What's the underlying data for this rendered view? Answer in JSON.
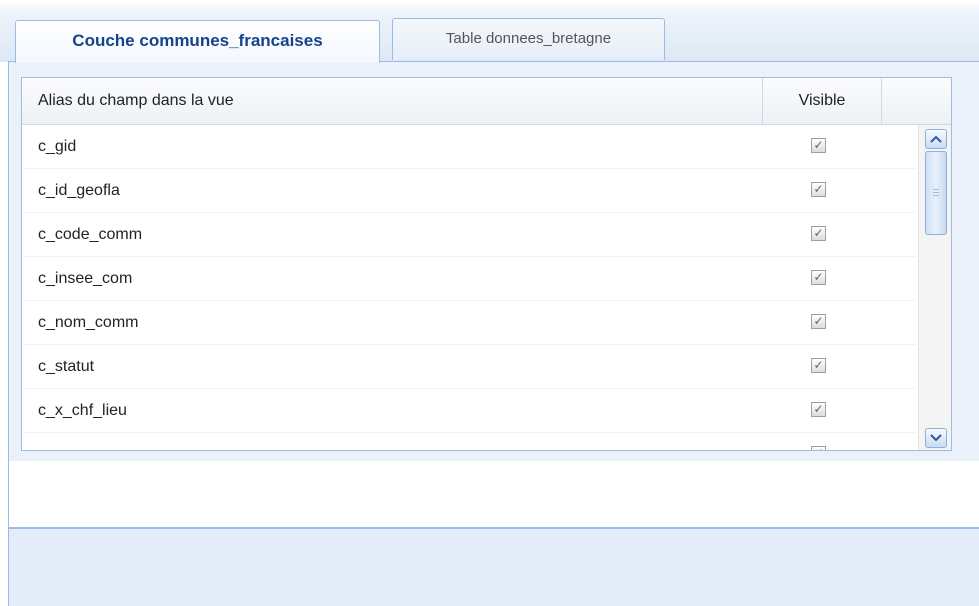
{
  "tabs": [
    {
      "label": "Couche communes_francaises",
      "active": true
    },
    {
      "label": "Table donnees_bretagne",
      "active": false
    }
  ],
  "grid": {
    "columns": [
      "Alias du champ dans la vue",
      "Visible"
    ],
    "rows": [
      {
        "alias": "c_gid",
        "visible": true
      },
      {
        "alias": "c_id_geofla",
        "visible": true
      },
      {
        "alias": "c_code_comm",
        "visible": true
      },
      {
        "alias": "c_insee_com",
        "visible": true
      },
      {
        "alias": "c_nom_comm",
        "visible": true
      },
      {
        "alias": "c_statut",
        "visible": true
      },
      {
        "alias": "c_x_chf_lieu",
        "visible": true
      }
    ],
    "check_glyph": "✓"
  },
  "scrollbar": {
    "up_icon": "chevron-up-icon",
    "down_icon": "chevron-down-icon"
  },
  "colors": {
    "accent": "#15428b",
    "border": "#99bbe8"
  }
}
